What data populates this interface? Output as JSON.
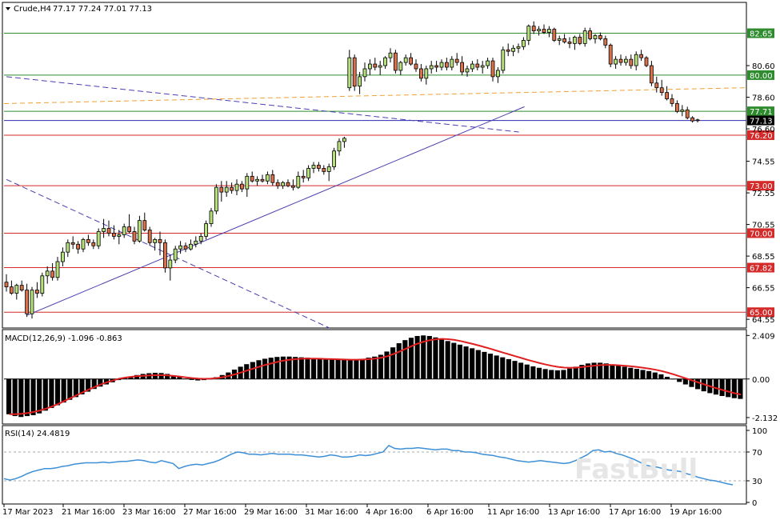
{
  "header": {
    "symbol": "Crude,H4",
    "ohlc": "77.17 77.24 77.01 77.13"
  },
  "macd_header": "MACD(12,26,9) -1.096 -0.863",
  "rsi_header": "RSI(14) 24.4819",
  "watermark": "FastBull",
  "colors": {
    "support_line": "#2e8b2e",
    "resistance_line": "#d42a2a",
    "trend_line": "#4a3fb0",
    "avg_line": "#f0a030",
    "bull_candle": "#b5e07a",
    "bear_candle": "#d9704a",
    "macd_hist": "#000000",
    "macd_signal": "#e02020",
    "rsi_line": "#3d8fd6",
    "current_price_box": "#000000"
  },
  "chart_data": [
    {
      "type": "candlestick",
      "title": "Crude,H4",
      "price_axis_ticks": [
        80.6,
        78.6,
        76.6,
        74.55,
        72.55,
        70.55,
        68.55,
        66.55,
        64.55
      ],
      "time_labels": [
        "17 Mar 2023",
        "21 Mar 16:00",
        "23 Mar 16:00",
        "27 Mar 16:00",
        "29 Mar 16:00",
        "31 Mar 16:00",
        "4 Apr 16:00",
        "6 Apr 16:00",
        "11 Apr 16:00",
        "13 Apr 16:00",
        "17 Apr 16:00",
        "19 Apr 16:00"
      ],
      "levels": [
        {
          "value": 82.65,
          "label": "82.65",
          "kind": "green"
        },
        {
          "value": 80.0,
          "label": "80.00",
          "kind": "green"
        },
        {
          "value": 77.71,
          "label": "77.71",
          "kind": "green"
        },
        {
          "value": 76.2,
          "label": "76.20",
          "kind": "red"
        },
        {
          "value": 73.0,
          "label": "73.00",
          "kind": "red"
        },
        {
          "value": 70.0,
          "label": "70.00",
          "kind": "red"
        },
        {
          "value": 67.82,
          "label": "67.82",
          "kind": "red"
        },
        {
          "value": 65.0,
          "label": "65.00",
          "kind": "red"
        }
      ],
      "current_price": {
        "value": 77.13,
        "label": "77.13"
      },
      "trendlines": [
        {
          "style": "dashed",
          "start": {
            "bar": 0,
            "price": 79.9
          },
          "end": {
            "bar": 92,
            "price": 76.4
          }
        },
        {
          "style": "dashed",
          "start": {
            "bar": 0,
            "price": 73.4
          },
          "end": {
            "bar": 58,
            "price": 64.0
          }
        },
        {
          "style": "solid",
          "start": {
            "bar": 4,
            "price": 64.8
          },
          "end": {
            "bar": 93,
            "price": 78.0
          }
        }
      ],
      "avg_line": {
        "start": {
          "bar": 0,
          "price": 78.2
        },
        "end": {
          "bar": 93,
          "price": 79.2
        }
      },
      "candles": [
        [
          66.9,
          67.4,
          66.3,
          66.6
        ],
        [
          66.6,
          67.0,
          66.1,
          66.2
        ],
        [
          66.2,
          66.8,
          65.8,
          66.7
        ],
        [
          66.7,
          67.0,
          66.3,
          66.4
        ],
        [
          66.4,
          66.8,
          64.7,
          64.9
        ],
        [
          64.9,
          66.6,
          64.6,
          66.4
        ],
        [
          66.4,
          66.9,
          65.9,
          66.2
        ],
        [
          66.2,
          67.5,
          66.0,
          67.3
        ],
        [
          67.3,
          67.9,
          66.8,
          67.6
        ],
        [
          67.6,
          68.1,
          67.0,
          67.2
        ],
        [
          67.2,
          68.5,
          67.0,
          68.2
        ],
        [
          68.2,
          69.1,
          67.9,
          68.8
        ],
        [
          68.8,
          69.6,
          68.5,
          69.4
        ],
        [
          69.4,
          69.8,
          69.0,
          69.3
        ],
        [
          69.3,
          69.5,
          68.7,
          69.0
        ],
        [
          69.0,
          69.7,
          68.8,
          69.6
        ],
        [
          69.6,
          69.9,
          69.2,
          69.4
        ],
        [
          69.4,
          69.6,
          69.0,
          69.2
        ],
        [
          69.2,
          70.3,
          69.0,
          70.1
        ],
        [
          70.1,
          70.9,
          69.7,
          70.3
        ],
        [
          70.3,
          70.8,
          69.8,
          70.0
        ],
        [
          70.0,
          70.5,
          69.6,
          69.8
        ],
        [
          69.8,
          70.2,
          69.3,
          69.9
        ],
        [
          69.9,
          70.6,
          69.7,
          70.4
        ],
        [
          70.4,
          71.2,
          70.0,
          70.1
        ],
        [
          70.1,
          70.4,
          69.3,
          69.5
        ],
        [
          69.5,
          71.1,
          69.4,
          70.8
        ],
        [
          70.8,
          71.3,
          70.1,
          70.2
        ],
        [
          70.2,
          70.4,
          69.2,
          69.4
        ],
        [
          69.4,
          69.7,
          68.9,
          69.6
        ],
        [
          69.6,
          70.1,
          68.6,
          69.4
        ],
        [
          69.4,
          69.6,
          67.5,
          67.8
        ],
        [
          67.8,
          68.6,
          67.0,
          68.3
        ],
        [
          68.3,
          69.2,
          68.1,
          69.0
        ],
        [
          69.0,
          69.5,
          68.7,
          69.2
        ],
        [
          69.2,
          69.4,
          68.8,
          69.0
        ],
        [
          69.0,
          69.6,
          68.9,
          69.3
        ],
        [
          69.3,
          69.8,
          69.1,
          69.5
        ],
        [
          69.5,
          70.0,
          69.3,
          69.8
        ],
        [
          69.8,
          70.8,
          69.6,
          70.6
        ],
        [
          70.6,
          71.6,
          70.4,
          71.4
        ],
        [
          71.4,
          73.1,
          71.2,
          72.9
        ],
        [
          72.9,
          73.3,
          72.0,
          72.6
        ],
        [
          72.6,
          73.3,
          72.3,
          72.9
        ],
        [
          72.9,
          73.2,
          72.5,
          72.7
        ],
        [
          72.7,
          73.4,
          72.4,
          73.1
        ],
        [
          73.1,
          73.3,
          72.6,
          72.8
        ],
        [
          72.8,
          73.8,
          72.3,
          73.6
        ],
        [
          73.6,
          73.9,
          73.2,
          73.3
        ],
        [
          73.3,
          73.6,
          73.0,
          73.4
        ],
        [
          73.4,
          73.7,
          73.2,
          73.3
        ],
        [
          73.3,
          73.9,
          73.1,
          73.7
        ],
        [
          73.7,
          74.0,
          73.0,
          73.2
        ],
        [
          73.2,
          73.4,
          72.8,
          73.0
        ],
        [
          73.0,
          73.3,
          72.8,
          73.2
        ],
        [
          73.2,
          73.4,
          72.9,
          73.0
        ],
        [
          73.0,
          73.4,
          72.7,
          72.9
        ],
        [
          72.9,
          73.9,
          72.8,
          73.6
        ],
        [
          73.6,
          74.0,
          73.2,
          73.5
        ],
        [
          73.5,
          74.3,
          73.3,
          74.1
        ],
        [
          74.1,
          74.5,
          73.8,
          74.3
        ],
        [
          74.3,
          74.5,
          73.9,
          74.1
        ],
        [
          74.1,
          74.3,
          73.7,
          73.9
        ],
        [
          73.9,
          74.4,
          73.3,
          74.2
        ],
        [
          74.2,
          75.4,
          74.0,
          75.2
        ],
        [
          75.2,
          76.0,
          74.9,
          75.8
        ],
        [
          75.8,
          76.1,
          75.4,
          76.0
        ],
        [
          79.2,
          81.6,
          79.0,
          81.1
        ],
        [
          81.1,
          81.3,
          79.0,
          79.3
        ],
        [
          79.3,
          80.2,
          78.8,
          79.9
        ],
        [
          79.9,
          80.8,
          79.6,
          80.4
        ],
        [
          80.4,
          81.0,
          80.0,
          80.7
        ],
        [
          80.7,
          81.1,
          80.3,
          80.5
        ],
        [
          80.5,
          80.9,
          80.0,
          80.6
        ],
        [
          80.6,
          81.2,
          80.4,
          81.1
        ],
        [
          81.1,
          81.7,
          80.8,
          81.4
        ],
        [
          81.4,
          81.6,
          80.1,
          80.3
        ],
        [
          80.3,
          80.9,
          80.0,
          80.8
        ],
        [
          80.8,
          81.3,
          80.6,
          81.1
        ],
        [
          81.1,
          81.4,
          80.6,
          80.7
        ],
        [
          80.7,
          81.0,
          80.2,
          80.4
        ],
        [
          80.4,
          80.7,
          79.6,
          79.8
        ],
        [
          79.8,
          80.6,
          79.4,
          80.4
        ]
      ],
      "candles_late": [
        [
          80.4,
          80.9,
          80.1,
          80.6
        ],
        [
          80.6,
          80.9,
          80.2,
          80.5
        ],
        [
          80.5,
          81.0,
          80.3,
          80.8
        ],
        [
          80.8,
          81.1,
          80.3,
          80.5
        ],
        [
          80.5,
          81.2,
          80.3,
          81.0
        ],
        [
          81.0,
          81.4,
          80.6,
          80.8
        ],
        [
          80.8,
          81.2,
          80.0,
          80.2
        ],
        [
          80.2,
          80.6,
          79.9,
          80.4
        ],
        [
          80.4,
          80.9,
          80.2,
          80.7
        ],
        [
          80.7,
          81.0,
          80.3,
          80.5
        ],
        [
          80.5,
          80.9,
          80.1,
          80.6
        ],
        [
          80.6,
          81.1,
          80.4,
          80.9
        ],
        [
          80.9,
          81.1,
          79.6,
          79.9
        ],
        [
          79.9,
          80.5,
          79.5,
          80.3
        ],
        [
          80.3,
          81.8,
          80.1,
          81.6
        ],
        [
          81.6,
          82.0,
          81.2,
          81.5
        ],
        [
          81.5,
          81.9,
          81.2,
          81.7
        ],
        [
          81.7,
          82.0,
          81.4,
          81.8
        ],
        [
          81.8,
          82.4,
          81.6,
          82.2
        ],
        [
          82.2,
          83.2,
          81.9,
          83.1
        ],
        [
          83.1,
          83.4,
          82.6,
          82.8
        ],
        [
          82.8,
          83.1,
          82.5,
          82.9
        ],
        [
          82.9,
          83.2,
          82.6,
          82.7
        ],
        [
          82.7,
          83.1,
          82.4,
          82.9
        ],
        [
          82.9,
          83.0,
          82.1,
          82.2
        ],
        [
          82.2,
          82.5,
          81.9,
          82.3
        ],
        [
          82.3,
          82.6,
          82.0,
          82.1
        ],
        [
          82.1,
          82.4,
          81.7,
          82.0
        ],
        [
          82.0,
          82.5,
          81.6,
          82.4
        ],
        [
          82.4,
          82.6,
          81.9,
          82.0
        ],
        [
          82.0,
          83.0,
          81.8,
          82.8
        ],
        [
          82.8,
          83.0,
          82.2,
          82.3
        ],
        [
          82.3,
          82.6,
          82.0,
          82.5
        ],
        [
          82.5,
          82.7,
          82.2,
          82.3
        ],
        [
          82.3,
          82.5,
          81.7,
          81.9
        ],
        [
          81.9,
          82.0,
          80.5,
          80.7
        ],
        [
          80.7,
          81.2,
          80.4,
          81.0
        ],
        [
          81.0,
          81.3,
          80.6,
          80.8
        ],
        [
          80.8,
          81.2,
          80.6,
          81.0
        ],
        [
          81.0,
          81.3,
          80.4,
          80.6
        ],
        [
          80.6,
          81.5,
          80.3,
          81.3
        ],
        [
          81.3,
          81.6,
          80.9,
          81.1
        ],
        [
          81.1,
          81.2,
          80.5,
          80.6
        ],
        [
          80.6,
          80.9,
          79.3,
          79.5
        ],
        [
          79.5,
          79.9,
          78.9,
          79.2
        ],
        [
          79.2,
          79.7,
          78.7,
          78.9
        ],
        [
          78.9,
          79.3,
          78.4,
          78.5
        ],
        [
          78.5,
          78.8,
          78.0,
          78.2
        ],
        [
          78.2,
          78.4,
          77.6,
          77.7
        ],
        [
          77.7,
          78.1,
          77.4,
          77.8
        ],
        [
          77.8,
          78.0,
          77.2,
          77.3
        ],
        [
          77.3,
          77.4,
          77.0,
          77.1
        ],
        [
          77.17,
          77.24,
          77.01,
          77.13
        ]
      ]
    },
    {
      "type": "bar",
      "title": "MACD(12,26,9) -1.096 -0.863",
      "axis_ticks": [
        2.409,
        0.0,
        -2.132
      ],
      "ylim": [
        -2.4,
        2.6
      ],
      "histogram": [
        -1.95,
        -2.05,
        -2.1,
        -2.05,
        -2.0,
        -1.9,
        -1.75,
        -1.6,
        -1.45,
        -1.3,
        -1.15,
        -1.0,
        -0.85,
        -0.7,
        -0.55,
        -0.42,
        -0.3,
        -0.18,
        -0.06,
        0.05,
        0.14,
        0.22,
        0.28,
        0.32,
        0.34,
        0.33,
        0.28,
        0.2,
        0.1,
        0.02,
        -0.05,
        -0.08,
        -0.06,
        0.0,
        0.1,
        0.22,
        0.36,
        0.52,
        0.68,
        0.82,
        0.94,
        1.04,
        1.12,
        1.18,
        1.22,
        1.24,
        1.24,
        1.22,
        1.2,
        1.18,
        1.16,
        1.14,
        1.12,
        1.1,
        1.08,
        1.07,
        1.06,
        1.08,
        1.12,
        1.18,
        1.24,
        1.34,
        1.52,
        1.75,
        1.98,
        2.15,
        2.28,
        2.38,
        2.41,
        2.38,
        2.3,
        2.2,
        2.1,
        2.0,
        1.9,
        1.8,
        1.7,
        1.6,
        1.5,
        1.4,
        1.3,
        1.2,
        1.1,
        1.0,
        0.9,
        0.8,
        0.7,
        0.62,
        0.55,
        0.5,
        0.48,
        0.5,
        0.58,
        0.68,
        0.78,
        0.86,
        0.9,
        0.9,
        0.86,
        0.8,
        0.74,
        0.68,
        0.62,
        0.56,
        0.5,
        0.44,
        0.36,
        0.26,
        0.12,
        -0.02,
        -0.16,
        -0.3,
        -0.44,
        -0.56,
        -0.68,
        -0.78,
        -0.86,
        -0.94,
        -1.0,
        -1.06,
        -1.1
      ],
      "signal": [
        -1.95,
        -1.95,
        -1.92,
        -1.88,
        -1.82,
        -1.74,
        -1.64,
        -1.52,
        -1.38,
        -1.22,
        -1.06,
        -0.9,
        -0.74,
        -0.58,
        -0.44,
        -0.3,
        -0.18,
        -0.08,
        0.02,
        0.08,
        0.12,
        0.16,
        0.18,
        0.2,
        0.21,
        0.21,
        0.2,
        0.17,
        0.13,
        0.09,
        0.05,
        0.02,
        0.01,
        0.02,
        0.05,
        0.1,
        0.17,
        0.26,
        0.36,
        0.47,
        0.58,
        0.68,
        0.78,
        0.87,
        0.95,
        1.02,
        1.07,
        1.1,
        1.12,
        1.13,
        1.13,
        1.12,
        1.11,
        1.1,
        1.09,
        1.08,
        1.07,
        1.07,
        1.08,
        1.1,
        1.13,
        1.18,
        1.26,
        1.38,
        1.52,
        1.67,
        1.82,
        1.96,
        2.07,
        2.15,
        2.2,
        2.22,
        2.2,
        2.16,
        2.1,
        2.02,
        1.94,
        1.85,
        1.76,
        1.66,
        1.56,
        1.46,
        1.36,
        1.26,
        1.16,
        1.06,
        0.97,
        0.88,
        0.8,
        0.73,
        0.67,
        0.63,
        0.62,
        0.63,
        0.66,
        0.7,
        0.74,
        0.77,
        0.78,
        0.78,
        0.76,
        0.73,
        0.7,
        0.66,
        0.62,
        0.57,
        0.51,
        0.44,
        0.35,
        0.25,
        0.14,
        0.03,
        -0.08,
        -0.19,
        -0.3,
        -0.41,
        -0.51,
        -0.61,
        -0.7,
        -0.79,
        -0.86
      ]
    },
    {
      "type": "line",
      "title": "RSI(14) 24.4819",
      "axis_ticks": [
        100,
        70,
        30,
        0
      ],
      "ylim": [
        0,
        100
      ],
      "levels": [
        70,
        30
      ],
      "values": [
        33,
        31,
        33,
        36,
        40,
        43,
        45,
        47,
        47,
        48,
        50,
        51,
        53,
        54,
        55,
        55,
        55,
        56,
        55,
        56,
        57,
        57,
        58,
        59,
        58,
        56,
        55,
        58,
        56,
        54,
        47,
        50,
        52,
        53,
        52,
        54,
        56,
        59,
        63,
        67,
        70,
        69,
        67,
        67,
        66,
        67,
        68,
        67,
        67,
        67,
        66,
        66,
        65,
        64,
        63,
        64,
        66,
        65,
        63,
        63,
        64,
        66,
        65,
        66,
        68,
        70,
        79,
        75,
        74,
        75,
        75,
        76,
        75,
        74,
        73,
        74,
        74,
        72,
        72,
        70,
        70,
        69,
        67,
        66,
        65,
        63,
        62,
        60,
        58,
        57,
        56,
        57,
        58,
        57,
        56,
        55,
        54,
        55,
        58,
        62,
        66,
        72,
        73,
        70,
        71,
        68,
        66,
        63,
        60,
        56,
        52,
        50,
        49,
        47,
        45,
        44,
        43,
        40,
        38,
        35,
        33,
        31,
        30,
        28,
        26,
        24.5
      ]
    }
  ]
}
